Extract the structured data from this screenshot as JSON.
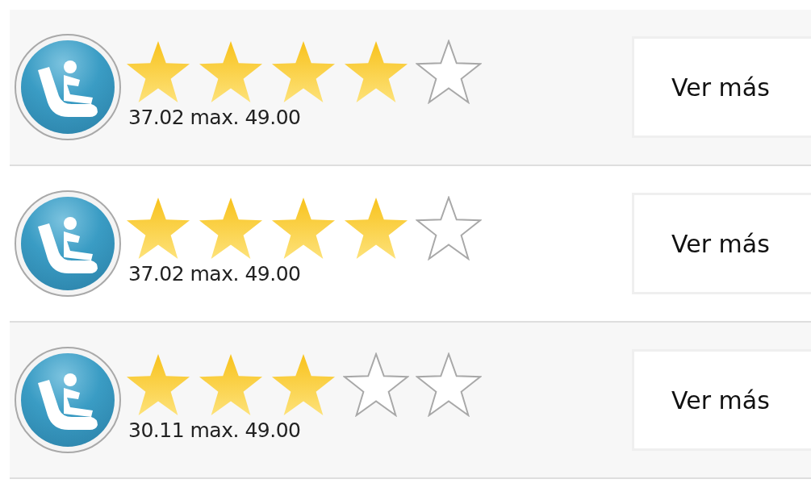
{
  "rows": [
    {
      "stars": 4,
      "score": "37.02 max. 49.00",
      "button": "Ver más"
    },
    {
      "stars": 4,
      "score": "37.02 max. 49.00",
      "button": "Ver más"
    },
    {
      "stars": 3,
      "score": "30.11 max. 49.00",
      "button": "Ver más"
    }
  ]
}
